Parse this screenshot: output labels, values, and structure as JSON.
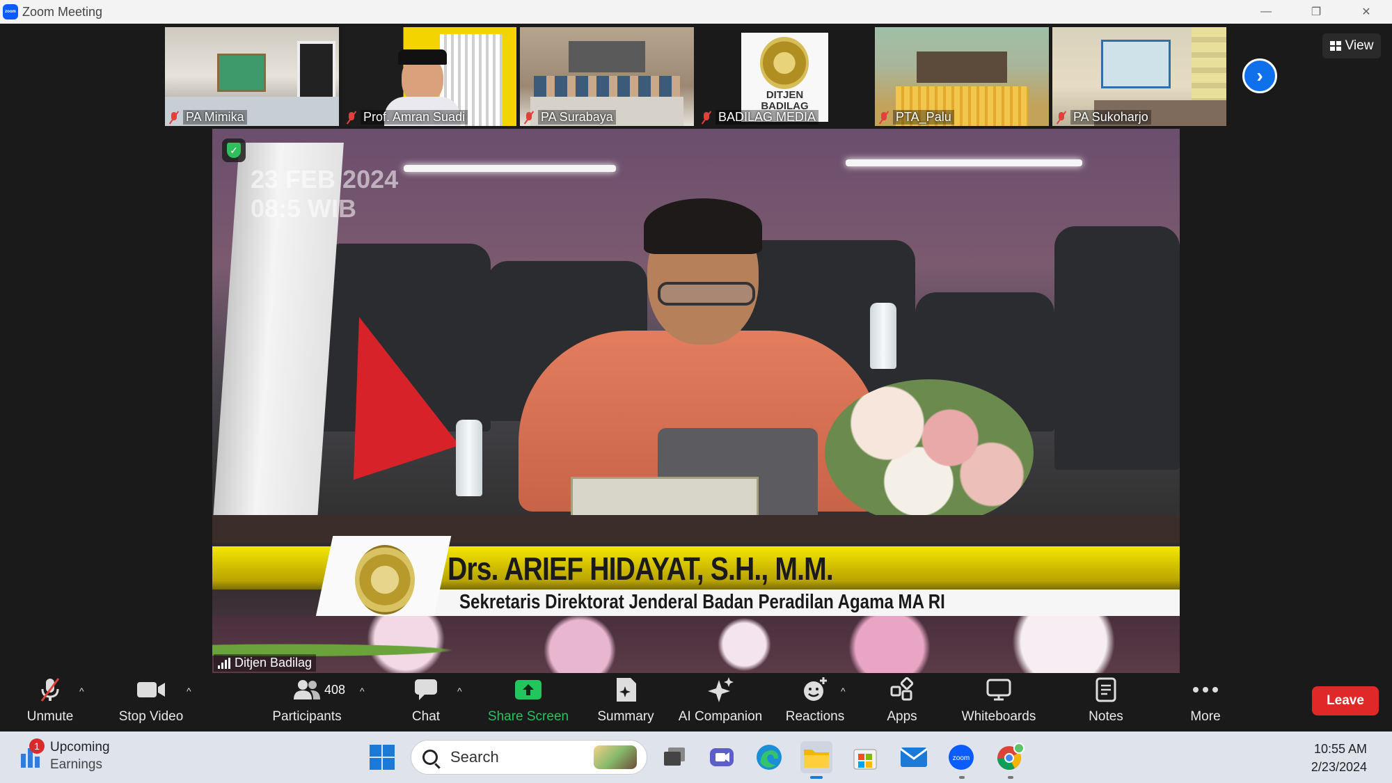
{
  "window": {
    "title": "Zoom Meeting",
    "app_icon_text": "zoom",
    "minimize": "—",
    "restore": "❐",
    "close": "✕"
  },
  "view_button": {
    "label": "View"
  },
  "thumbnails": [
    {
      "name": "PA Mimika"
    },
    {
      "name": "Prof. Amran Suadi"
    },
    {
      "name": "PA Surabaya"
    },
    {
      "name": "BADILAG MEDIA"
    },
    {
      "name": "PTA_Palu"
    },
    {
      "name": "PA Sukoharjo"
    }
  ],
  "badilag_logo_text": "DITJEN BADILAG",
  "main_video": {
    "speaker_label": "Ditjen Badilag",
    "stamp_date": "23 FEB 2024",
    "stamp_time": "08:5  WIB",
    "caption_title": "Drs. ARIEF HIDAYAT, S.H., M.M.",
    "caption_subtitle": "Sekretaris Direktorat Jenderal Badan Peradilan Agama MA RI"
  },
  "toolbar": {
    "unmute": "Unmute",
    "stop_video": "Stop Video",
    "participants": "Participants",
    "participant_count": "408",
    "chat": "Chat",
    "share_screen": "Share Screen",
    "summary": "Summary",
    "ai_companion": "AI Companion",
    "reactions": "Reactions",
    "apps": "Apps",
    "whiteboards": "Whiteboards",
    "notes": "Notes",
    "more": "More",
    "leave": "Leave"
  },
  "taskbar": {
    "widget_line1": "Upcoming",
    "widget_line2": "Earnings",
    "widget_badge": "1",
    "search_placeholder": "Search",
    "time": "10:55 AM",
    "date": "2/23/2024"
  },
  "colors": {
    "accent": "#0e71eb",
    "share_green": "#23c55e",
    "leave_red": "#e02828",
    "muted_red": "#e0413b"
  }
}
